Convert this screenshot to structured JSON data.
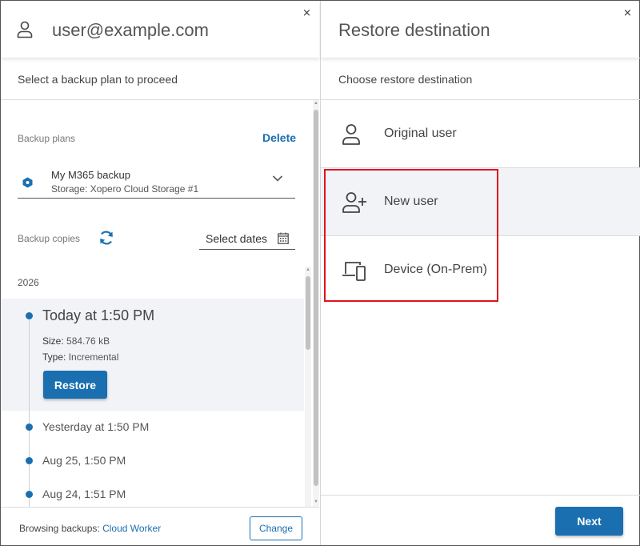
{
  "left_panel": {
    "title": "user@example.com",
    "subtitle": "Select a backup plan to proceed",
    "close_icon": "×",
    "backup_plans_label": "Backup plans",
    "delete_label": "Delete",
    "plan": {
      "name": "My M365 backup",
      "storage": "Storage: Xopero Cloud Storage #1"
    },
    "backup_copies_label": "Backup copies",
    "select_dates_label": "Select dates",
    "year": "2026",
    "copies": [
      {
        "title": "Today at 1:50 PM",
        "size_label": "Size:",
        "size": "584.76 kB",
        "type_label": "Type:",
        "type": "Incremental",
        "restore_label": "Restore"
      },
      {
        "title": "Yesterday at 1:50 PM"
      },
      {
        "title": "Aug 25, 1:50 PM"
      },
      {
        "title": "Aug 24, 1:51 PM"
      }
    ],
    "footer": {
      "browsing_label": "Browsing backups:",
      "worker": "Cloud Worker",
      "change_label": "Change"
    }
  },
  "right_panel": {
    "title": "Restore destination",
    "subtitle": "Choose restore destination",
    "close_icon": "×",
    "destinations": [
      {
        "label": "Original user",
        "icon": "user-icon"
      },
      {
        "label": "New user",
        "icon": "user-plus-icon"
      },
      {
        "label": "Device (On-Prem)",
        "icon": "devices-icon"
      }
    ],
    "next_label": "Next"
  },
  "colors": {
    "accent": "#1a6fb0",
    "highlight": "#e0141e",
    "selected_bg": "#f1f3f7"
  }
}
